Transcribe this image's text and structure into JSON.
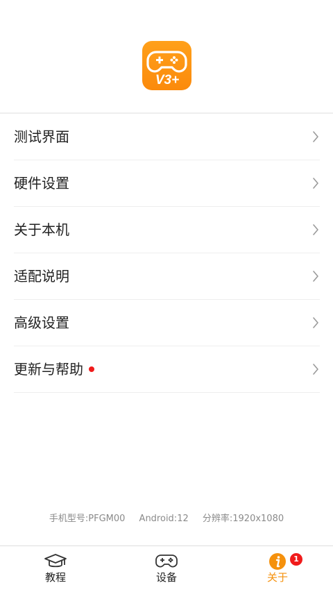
{
  "app": {
    "logo_text": "V3+",
    "accent_color": "#f5910d"
  },
  "menu": {
    "items": [
      {
        "label": "测试界面",
        "icon": "chevron-right-icon"
      },
      {
        "label": "硬件设置",
        "icon": "chevron-right-icon"
      },
      {
        "label": "关于本机",
        "icon": "chevron-right-icon"
      },
      {
        "label": "适配说明",
        "icon": "chevron-right-icon"
      },
      {
        "label": "高级设置",
        "icon": "chevron-right-icon"
      },
      {
        "label": "更新与帮助",
        "icon": "chevron-right-icon",
        "has_dot": true
      }
    ]
  },
  "device_info": {
    "model": "手机型号:PFGM00",
    "android": "Android:12",
    "resolution": "分辨率:1920x1080"
  },
  "tabbar": {
    "tabs": [
      {
        "label": "教程",
        "icon": "graduation-cap-icon",
        "active": false
      },
      {
        "label": "设备",
        "icon": "gamepad-icon",
        "active": false
      },
      {
        "label": "关于",
        "icon": "info-icon",
        "active": true,
        "badge": "1"
      }
    ]
  }
}
